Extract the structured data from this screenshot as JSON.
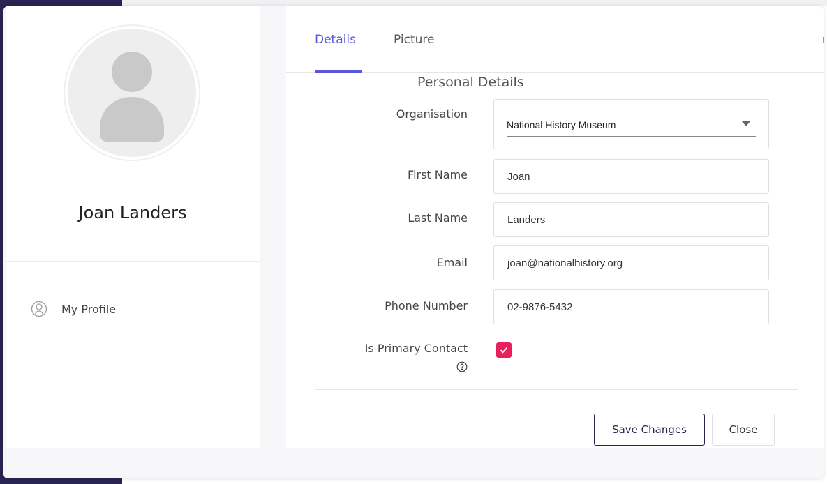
{
  "profile": {
    "name": "Joan Landers",
    "nav_items": [
      {
        "label": "My Profile",
        "icon": "user-icon"
      }
    ]
  },
  "tabs": [
    {
      "label": "Details",
      "active": true
    },
    {
      "label": "Picture",
      "active": false
    }
  ],
  "tab_edge_glyph": "r",
  "form": {
    "section_title": "Personal Details",
    "organisation": {
      "label": "Organisation",
      "value": "National History Museum"
    },
    "first_name": {
      "label": "First Name",
      "value": "Joan"
    },
    "last_name": {
      "label": "Last Name",
      "value": "Landers"
    },
    "email": {
      "label": "Email",
      "value": "joan@nationalhistory.org"
    },
    "phone": {
      "label": "Phone Number",
      "value": "02-9876-5432"
    },
    "primary_contact": {
      "label": "Is Primary Contact",
      "checked": true,
      "help_icon": "question-circle-icon"
    }
  },
  "buttons": {
    "save": "Save Changes",
    "close": "Close"
  },
  "colors": {
    "accent": "#5a58d6",
    "checkbox": "#e8215d",
    "brand_dark": "#2a2453"
  }
}
